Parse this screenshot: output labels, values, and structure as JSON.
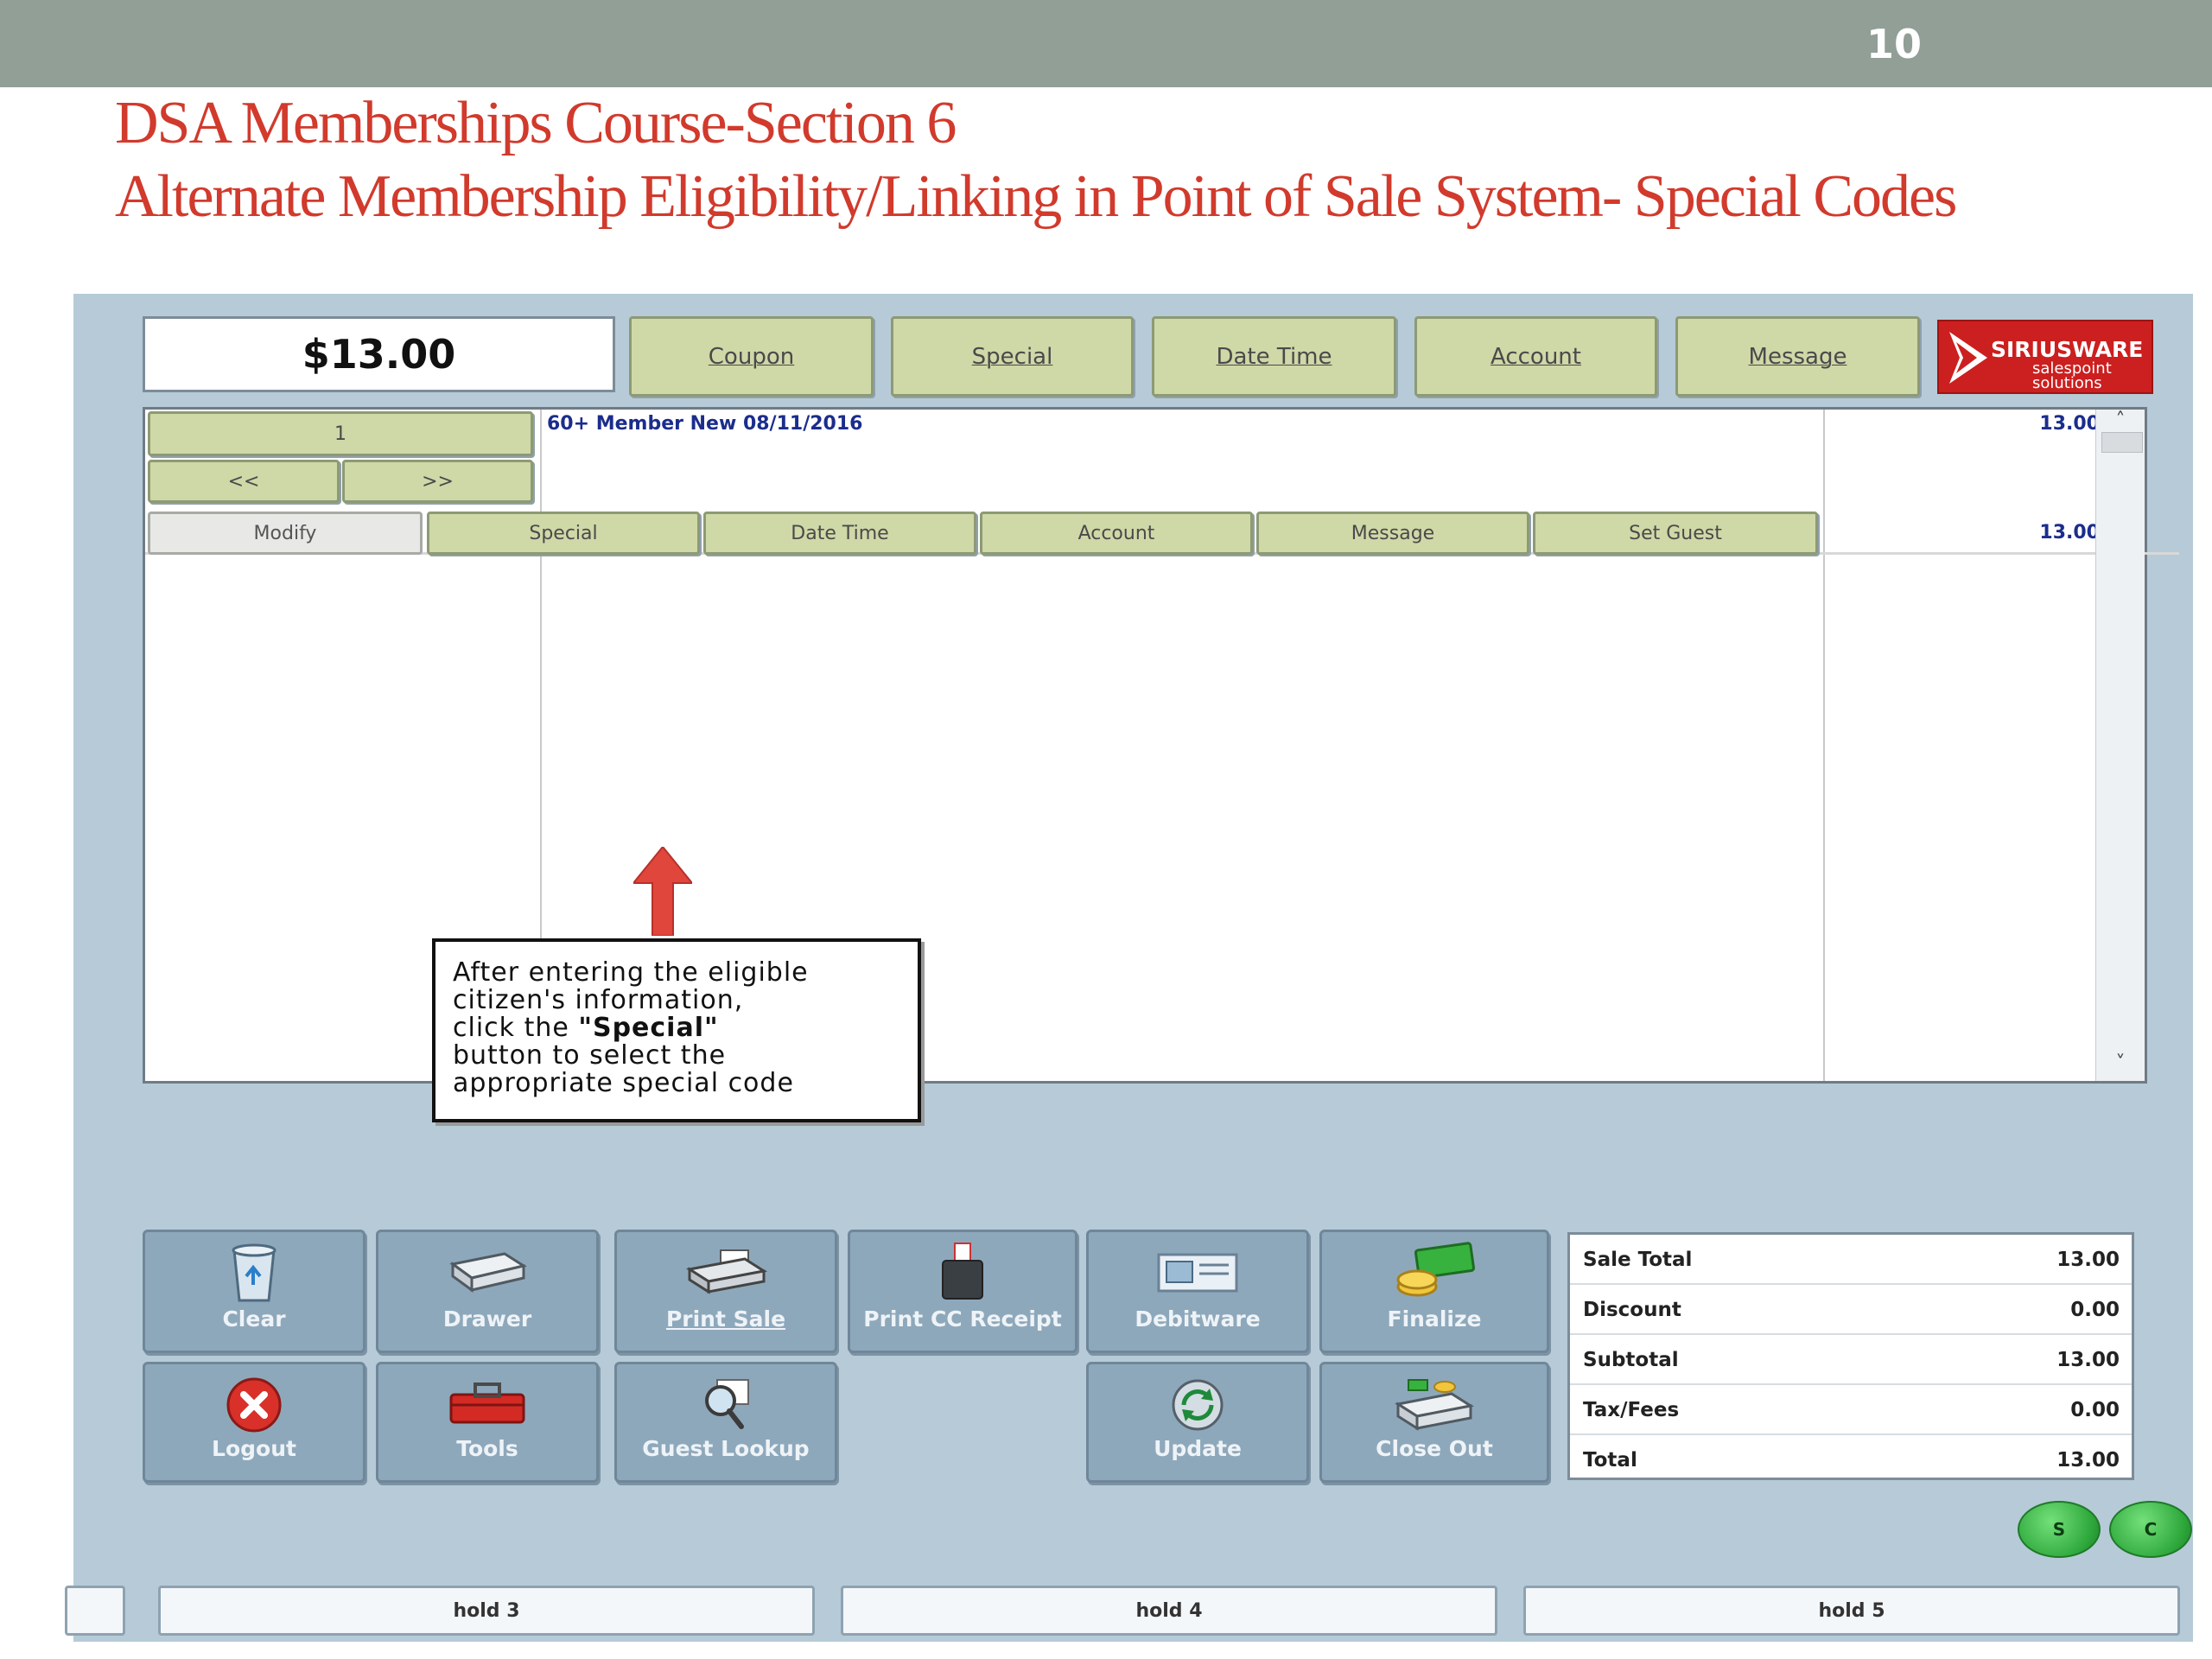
{
  "slide": {
    "page_number": "10",
    "title_line1": "DSA Memberships Course-Section 6",
    "title_line2": "Alternate Membership Eligibility/Linking in Point of Sale System- Special Codes"
  },
  "pos": {
    "total_display": "$13.00",
    "top_buttons": [
      "Coupon",
      "Special",
      "Date Time",
      "Account",
      "Message"
    ],
    "logo": {
      "brand": "SIRIUSWARE",
      "sub_line1": "salespoint",
      "sub_line2": "solutions"
    },
    "qty_label": "1",
    "prev_label": "<<",
    "next_label": ">>",
    "item": {
      "description": "60+ Member New 08/11/2016",
      "price": "13.00",
      "line_total": "13.00"
    },
    "item_buttons": [
      "Modify",
      "Special",
      "Date Time",
      "Account",
      "Message",
      "Set Guest"
    ],
    "scroll_up": "˄",
    "scroll_down": "˅",
    "callout": {
      "line1": "After entering the eligible",
      "line2": "citizen's information,",
      "line3_pre": "click the ",
      "line3_bold": "\"Special\"",
      "line4": "button to select the",
      "line5": "appropriate special code"
    },
    "actions_row1": [
      "Clear",
      "Drawer",
      "Print Sale",
      "Print CC Receipt",
      "Debitware",
      "Finalize"
    ],
    "actions_row2": [
      "Logout",
      "Tools",
      "Guest Lookup",
      "Update",
      "Close Out"
    ],
    "totals": [
      {
        "label": "Sale Total",
        "value": "13.00"
      },
      {
        "label": "Discount",
        "value": "0.00"
      },
      {
        "label": "Subtotal",
        "value": "13.00"
      },
      {
        "label": "Tax/Fees",
        "value": "0.00"
      },
      {
        "label": "Total",
        "value": "13.00"
      }
    ],
    "round_buttons": [
      "S",
      "C"
    ],
    "holds": [
      "hold 3",
      "hold 4",
      "hold 5"
    ]
  },
  "colors": {
    "title_red": "#d13a2c",
    "header_gray": "#919f97",
    "panel_blue": "#b6cbd7",
    "button_green": "#cfd8a7",
    "action_blue": "#8ea8bb"
  }
}
